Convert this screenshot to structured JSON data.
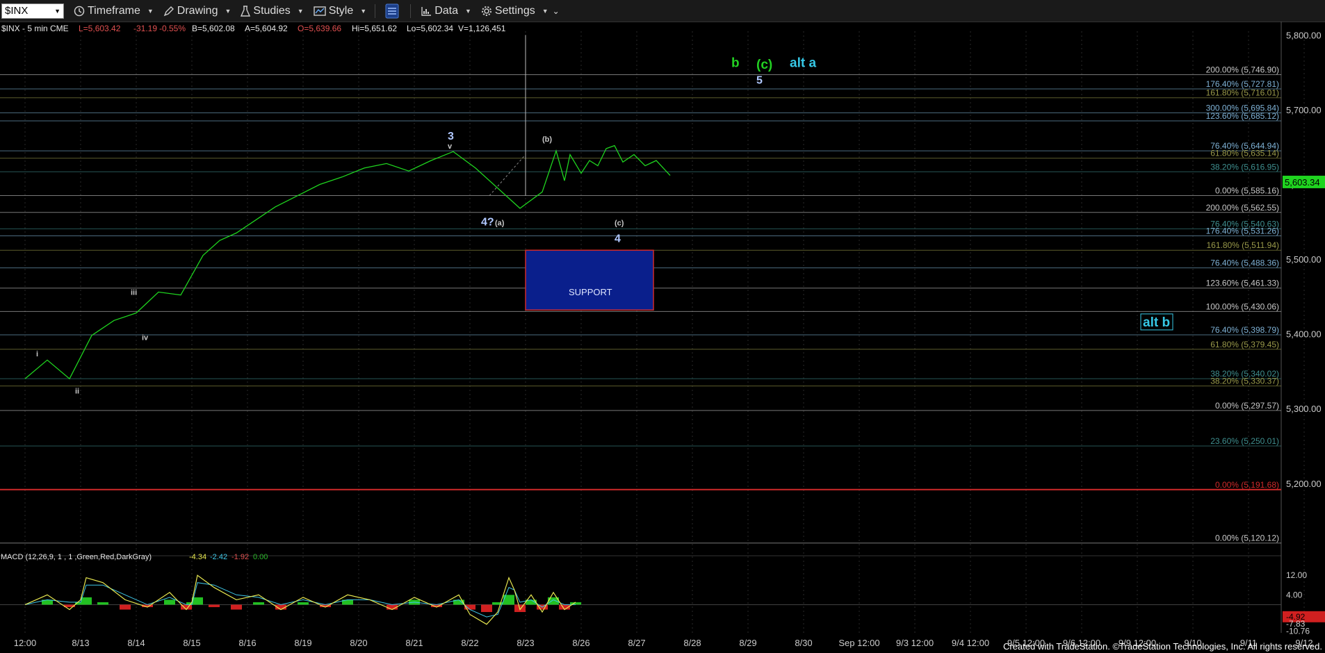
{
  "toolbar": {
    "symbol": "$INX",
    "items": [
      {
        "label": "Timeframe",
        "icon": "clock-icon"
      },
      {
        "label": "Drawing",
        "icon": "pencil-icon"
      },
      {
        "label": "Studies",
        "icon": "studies-icon"
      },
      {
        "label": "Style",
        "icon": "style-icon"
      },
      {
        "label": "",
        "icon": "layout-icon"
      },
      {
        "label": "Data",
        "icon": "data-icon"
      },
      {
        "label": "Settings",
        "icon": "gear-icon"
      }
    ]
  },
  "header": {
    "symbol_line": "$INX - 5 min  CME",
    "last": "L=5,603.42",
    "change": "-31.19",
    "pct": "-0.55%",
    "bid": "B=5,602.08",
    "ask": "A=5,604.92",
    "open": "O=5,639.66",
    "high": "Hi=5,651.62",
    "low": "Lo=5,602.34",
    "volume": "V=1,126,451"
  },
  "colors": {
    "price": "#1fd41f",
    "up": "#e03030",
    "axis": "#cccccc",
    "support_fill": "#0a1f8c",
    "support_border": "#d02a2a",
    "fib_blue": "#7fb2d6",
    "fib_olive": "#9a9a4a",
    "fib_teal": "#3f8f8f"
  },
  "chart_data": {
    "type": "line",
    "title": "",
    "xlabel": "",
    "ylabel": "",
    "ylim": [
      5105,
      5805
    ],
    "y_ticks": [
      "5,800.00",
      "5,700.00",
      "5,600.00",
      "5,500.00",
      "5,400.00",
      "5,300.00",
      "5,200.00"
    ],
    "y_tick_values": [
      5800,
      5700,
      5600,
      5500,
      5400,
      5300,
      5200
    ],
    "x_tick_labels": [
      "12:00",
      "8/13",
      "8/14",
      "8/15",
      "8/16",
      "8/19",
      "8/20",
      "8/21",
      "8/22",
      "8/23",
      "8/26",
      "8/27",
      "8/28",
      "8/29",
      "8/30",
      "Sep 12:00",
      "9/3 12:00",
      "9/4 12:00",
      "9/5 12:00",
      "9/6 12:00",
      "9/9 12:00",
      "9/10",
      "9/11",
      "9/12"
    ],
    "last_price": "5,603.34",
    "series": [
      {
        "x": [
          0,
          0.4,
          0.8,
          1.2,
          1.6,
          2.0,
          2.4,
          2.8,
          3.2,
          3.5,
          3.8,
          4.1,
          4.5,
          4.9,
          5.3,
          5.7,
          6.1,
          6.5,
          6.9,
          7.3,
          7.7,
          8.1,
          8.5,
          8.9,
          9.3,
          9.55,
          9.7,
          9.8,
          10.0,
          10.15,
          10.3,
          10.45,
          10.6,
          10.75,
          10.95,
          11.15,
          11.35,
          11.6
        ],
        "y": [
          5340,
          5365,
          5340,
          5398,
          5418,
          5428,
          5456,
          5452,
          5505,
          5525,
          5535,
          5550,
          5570,
          5585,
          5600,
          5610,
          5622,
          5628,
          5618,
          5632,
          5644,
          5622,
          5595,
          5568,
          5590,
          5645,
          5605,
          5640,
          5615,
          5632,
          5625,
          5648,
          5652,
          5630,
          5640,
          5625,
          5632,
          5612
        ]
      }
    ],
    "fib_levels": [
      {
        "label": "200.00% (5,746.90)",
        "value": 5746.9,
        "color": "#c8c8c8"
      },
      {
        "label": "176.40% (5,727.81)",
        "value": 5727.81,
        "color": "#7fb2d6"
      },
      {
        "label": "161.80% (5,716.01)",
        "value": 5716.01,
        "color": "#9a9a4a"
      },
      {
        "label": "300.00% (5,695.84)",
        "value": 5695.84,
        "color": "#7fb2d6"
      },
      {
        "label": "123.60% (5,685.12)",
        "value": 5685.12,
        "color": "#7fb2d6"
      },
      {
        "label": "76.40% (5,644.94)",
        "value": 5644.94,
        "color": "#7fb2d6"
      },
      {
        "label": "61.80% (5,635.14)",
        "value": 5635.14,
        "color": "#9a9a4a"
      },
      {
        "label": "38.20% (5,616.95)",
        "value": 5616.95,
        "color": "#3f8f8f"
      },
      {
        "label": "0.00% (5,585.16)",
        "value": 5585.16,
        "color": "#c8c8c8"
      },
      {
        "label": "200.00% (5,562.55)",
        "value": 5562.55,
        "color": "#c8c8c8"
      },
      {
        "label": "76.40% (5,540.63)",
        "value": 5540.63,
        "color": "#3f8f8f"
      },
      {
        "label": "176.40% (5,531.26)",
        "value": 5531.26,
        "color": "#7fb2d6"
      },
      {
        "label": "161.80% (5,511.94)",
        "value": 5511.94,
        "color": "#9a9a4a"
      },
      {
        "label": "76.40% (5,488.36)",
        "value": 5488.36,
        "color": "#7fb2d6"
      },
      {
        "label": "123.60% (5,461.33)",
        "value": 5461.33,
        "color": "#c8c8c8"
      },
      {
        "label": "100.00% (5,430.06)",
        "value": 5430.06,
        "color": "#c8c8c8"
      },
      {
        "label": "76.40% (5,398.79)",
        "value": 5398.79,
        "color": "#7fb2d6"
      },
      {
        "label": "61.80% (5,379.45)",
        "value": 5379.45,
        "color": "#9a9a4a"
      },
      {
        "label": "38.20% (5,340.02)",
        "value": 5340.02,
        "color": "#3f8f8f"
      },
      {
        "label": "38.20% (5,330.37)",
        "value": 5330.37,
        "color": "#9a9a4a"
      },
      {
        "label": "0.00% (5,297.57)",
        "value": 5297.57,
        "color": "#c8c8c8"
      },
      {
        "label": "23.60% (5,250.01)",
        "value": 5250.01,
        "color": "#3f8f8f"
      },
      {
        "label": "0.00% (5,191.68)",
        "value": 5191.68,
        "color": "#d02a2a"
      },
      {
        "label": "0.00% (5,120.12)",
        "value": 5120.12,
        "color": "#c8c8c8"
      }
    ],
    "wave_labels": [
      {
        "text": "i",
        "x": 0.2,
        "y": 5370,
        "color": "#c8c8c8"
      },
      {
        "text": "ii",
        "x": 0.9,
        "y": 5320,
        "color": "#c8c8c8"
      },
      {
        "text": "iii",
        "x": 1.9,
        "y": 5452,
        "color": "#c8c8c8"
      },
      {
        "text": "iv",
        "x": 2.1,
        "y": 5392,
        "color": "#c8c8c8"
      },
      {
        "text": "3",
        "x": 7.6,
        "y": 5660,
        "color": "#b0c8ff"
      },
      {
        "text": "v",
        "x": 7.6,
        "y": 5648,
        "color": "#c8c8c8"
      },
      {
        "text": "4?",
        "x": 8.2,
        "y": 5545,
        "color": "#b0c8ff"
      },
      {
        "text": "(a)",
        "x": 8.45,
        "y": 5545,
        "color": "#c8c8c8"
      },
      {
        "text": "(b)",
        "x": 9.3,
        "y": 5657,
        "color": "#c8c8c8"
      },
      {
        "text": "(c)",
        "x": 10.6,
        "y": 5545,
        "color": "#c8c8c8"
      },
      {
        "text": "4",
        "x": 10.6,
        "y": 5523,
        "color": "#b0c8ff"
      },
      {
        "text": "b",
        "x": 12.7,
        "y": 5757,
        "color": "#22d022"
      },
      {
        "text": "(c)",
        "x": 13.15,
        "y": 5755,
        "color": "#22d022"
      },
      {
        "text": "alt a",
        "x": 13.75,
        "y": 5757,
        "color": "#36c8e6"
      },
      {
        "text": "5",
        "x": 13.15,
        "y": 5735,
        "color": "#b0c8ff"
      },
      {
        "text": "alt b",
        "x": 20.1,
        "y": 5410,
        "color": "#36c8e6"
      }
    ],
    "support_zone": {
      "label": "SUPPORT",
      "x0": 9.0,
      "x1": 11.3,
      "y0": 5432,
      "y1": 5512
    }
  },
  "macd": {
    "label": "MACD (12,26,9, 1 , 1 ,Green,Red,DarkGray)",
    "v1": "-4.34",
    "v2": "-2.42",
    "v3": "-1.92",
    "v4": "0.00",
    "ticks": [
      "12.00",
      "4.00",
      "-4.92",
      "-7.83",
      "-10.76"
    ],
    "tick_values": [
      12,
      4,
      -4.92,
      -7.83,
      -10.76
    ],
    "ylim": [
      -11.5,
      16
    ],
    "line_x": [
      0,
      0.4,
      0.8,
      1.0,
      1.1,
      1.4,
      1.8,
      2.2,
      2.6,
      2.9,
      3.0,
      3.1,
      3.4,
      3.8,
      4.2,
      4.6,
      5.0,
      5.4,
      5.8,
      6.2,
      6.6,
      7.0,
      7.4,
      7.8,
      8.0,
      8.3,
      8.5,
      8.7,
      8.8,
      8.9,
      9.1,
      9.3,
      9.5,
      9.7,
      9.9
    ],
    "line_y": [
      0,
      4,
      -2,
      2,
      11,
      9,
      2,
      -1,
      5,
      -2,
      1,
      12,
      7,
      2,
      4,
      -2,
      3,
      -1,
      4,
      2,
      -2,
      3,
      -1,
      4,
      -4,
      -8,
      -3,
      11,
      6,
      -2,
      4,
      -3,
      5,
      -2,
      1
    ],
    "signal_y": [
      0,
      2,
      1,
      1,
      8,
      8,
      4,
      0,
      3,
      0,
      0,
      9,
      8,
      4,
      3,
      0,
      2,
      0,
      2,
      2,
      0,
      1,
      0,
      2,
      -2,
      -5,
      -4,
      7,
      6,
      1,
      2,
      -1,
      2,
      0,
      0
    ],
    "histogram": [
      0,
      2,
      -1,
      1,
      3,
      1,
      -2,
      -1,
      2,
      -2,
      1,
      3,
      -1,
      -2,
      1,
      -2,
      1,
      -1,
      2,
      0,
      -2,
      2,
      -1,
      2,
      -2,
      -3,
      1,
      4,
      0,
      -3,
      2,
      -2,
      3,
      -2,
      1
    ]
  },
  "footer": "Created with TradeStation. ©TradeStation Technologies, Inc. All rights reserved."
}
